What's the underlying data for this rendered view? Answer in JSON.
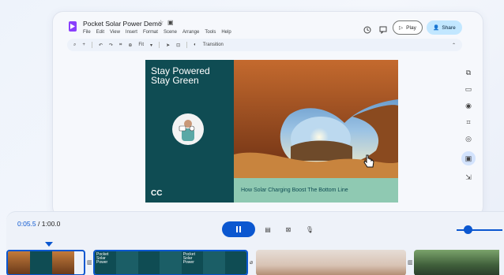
{
  "app": {
    "title": "Pocket Solar Power Demo",
    "menu": [
      "File",
      "Edit",
      "View",
      "Insert",
      "Format",
      "Scene",
      "Arrange",
      "Tools",
      "Help"
    ],
    "play_label": "Play",
    "share_label": "Share"
  },
  "toolbar": {
    "zoom_label": "Fit",
    "transition_label": "Transition"
  },
  "slide": {
    "title": "Stay Powered\nStay Green",
    "caption": "How Solar Charging Boost The Bottom Line",
    "logo_text": "CC"
  },
  "timeline": {
    "current_time": "0:05.5",
    "total_time": "1:00.0",
    "clip_label": "Pocket Solar Power"
  },
  "colors": {
    "accent": "#0b57d0",
    "slide_teal": "#0f4c53",
    "caption_green": "#8fc9b2",
    "share_bg": "#c2e7ff"
  }
}
